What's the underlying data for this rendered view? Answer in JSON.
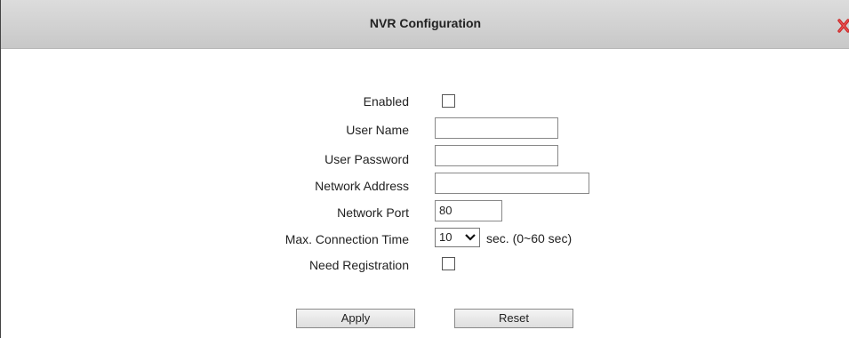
{
  "dialog": {
    "title": "NVR Configuration",
    "close_icon": "close-x-icon"
  },
  "form": {
    "enabled": {
      "label": "Enabled",
      "checked": false
    },
    "user_name": {
      "label": "User Name",
      "value": ""
    },
    "user_password": {
      "label": "User Password",
      "value": ""
    },
    "network_address": {
      "label": "Network Address",
      "value": ""
    },
    "network_port": {
      "label": "Network Port",
      "value": "80"
    },
    "max_connection_time": {
      "label": "Max. Connection Time",
      "value": "10",
      "hint": "sec. (0~60 sec)"
    },
    "need_registration": {
      "label": "Need Registration",
      "checked": false
    }
  },
  "buttons": {
    "apply": "Apply",
    "reset": "Reset"
  },
  "colors": {
    "titlebar": "#d0d0d0",
    "close_icon": "#cc2222"
  }
}
